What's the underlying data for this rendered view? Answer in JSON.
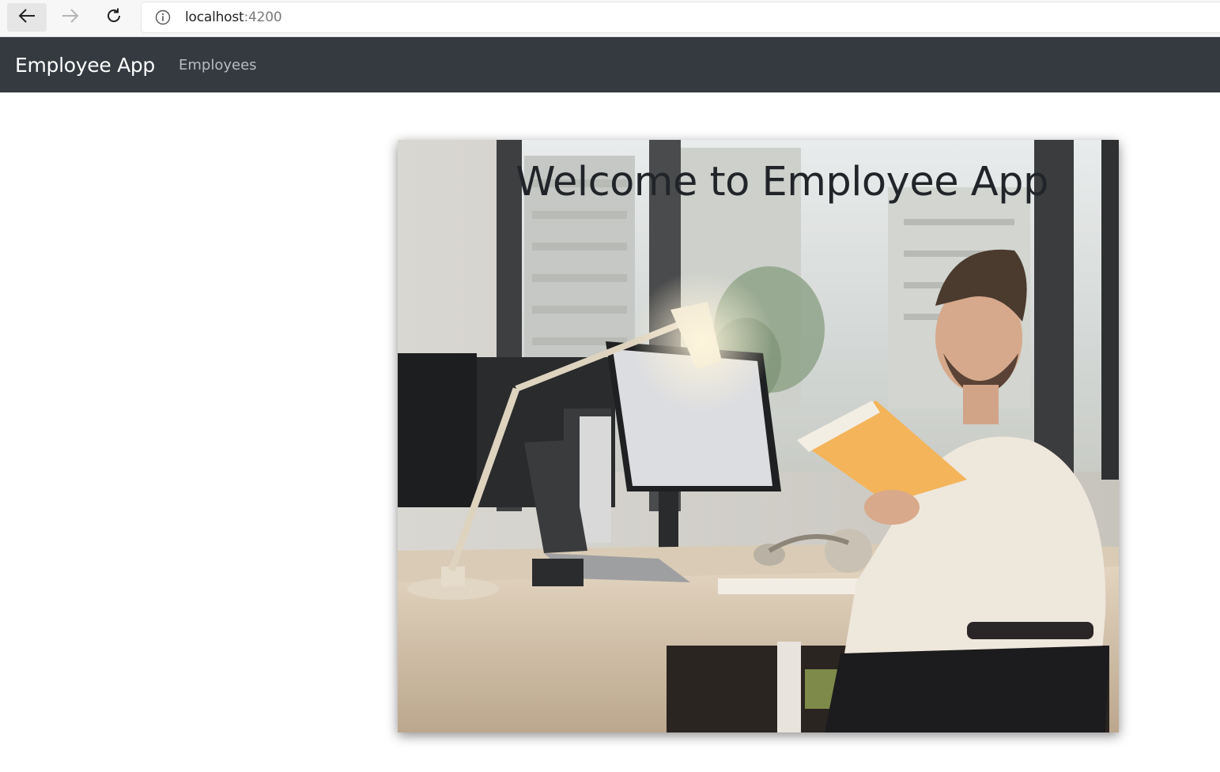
{
  "browser": {
    "url_host": "localhost",
    "url_port": ":4200",
    "icons": {
      "back": "back-arrow-icon",
      "forward": "forward-arrow-icon",
      "reload": "reload-icon",
      "info": "info-icon"
    }
  },
  "navbar": {
    "brand": "Employee App",
    "links": [
      {
        "label": "Employees"
      }
    ],
    "colors": {
      "background": "#343a40",
      "brand": "#ffffff",
      "link": "#b9bcbf"
    }
  },
  "hero": {
    "title": "Welcome to Employee App",
    "image_description_name": "office-worker-photo"
  }
}
